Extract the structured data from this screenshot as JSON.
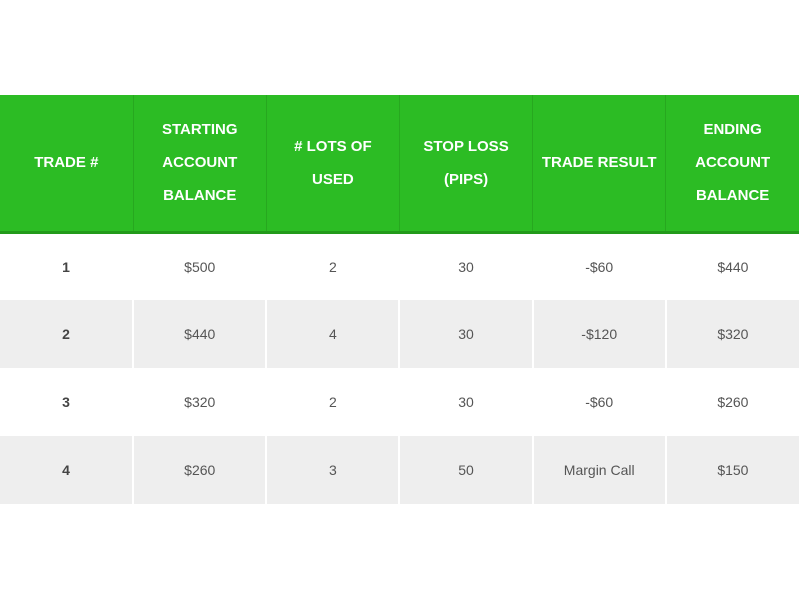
{
  "table": {
    "headers": [
      "TRADE #",
      "STARTING ACCOUNT BALANCE",
      "# LOTS OF USED",
      "STOP LOSS (PIPS)",
      "TRADE RESULT",
      "ENDING ACCOUNT BALANCE"
    ],
    "rows": [
      [
        "1",
        "$500",
        "2",
        "30",
        "-$60",
        "$440"
      ],
      [
        "2",
        "$440",
        "4",
        "30",
        "-$120",
        "$320"
      ],
      [
        "3",
        "$320",
        "2",
        "30",
        "-$60",
        "$260"
      ],
      [
        "4",
        "$260",
        "3",
        "50",
        "Margin Call",
        "$150"
      ]
    ]
  },
  "colors": {
    "header_bg": "#2cbc24",
    "header_text": "#ffffff",
    "row_alt_bg": "#eeeeee"
  }
}
